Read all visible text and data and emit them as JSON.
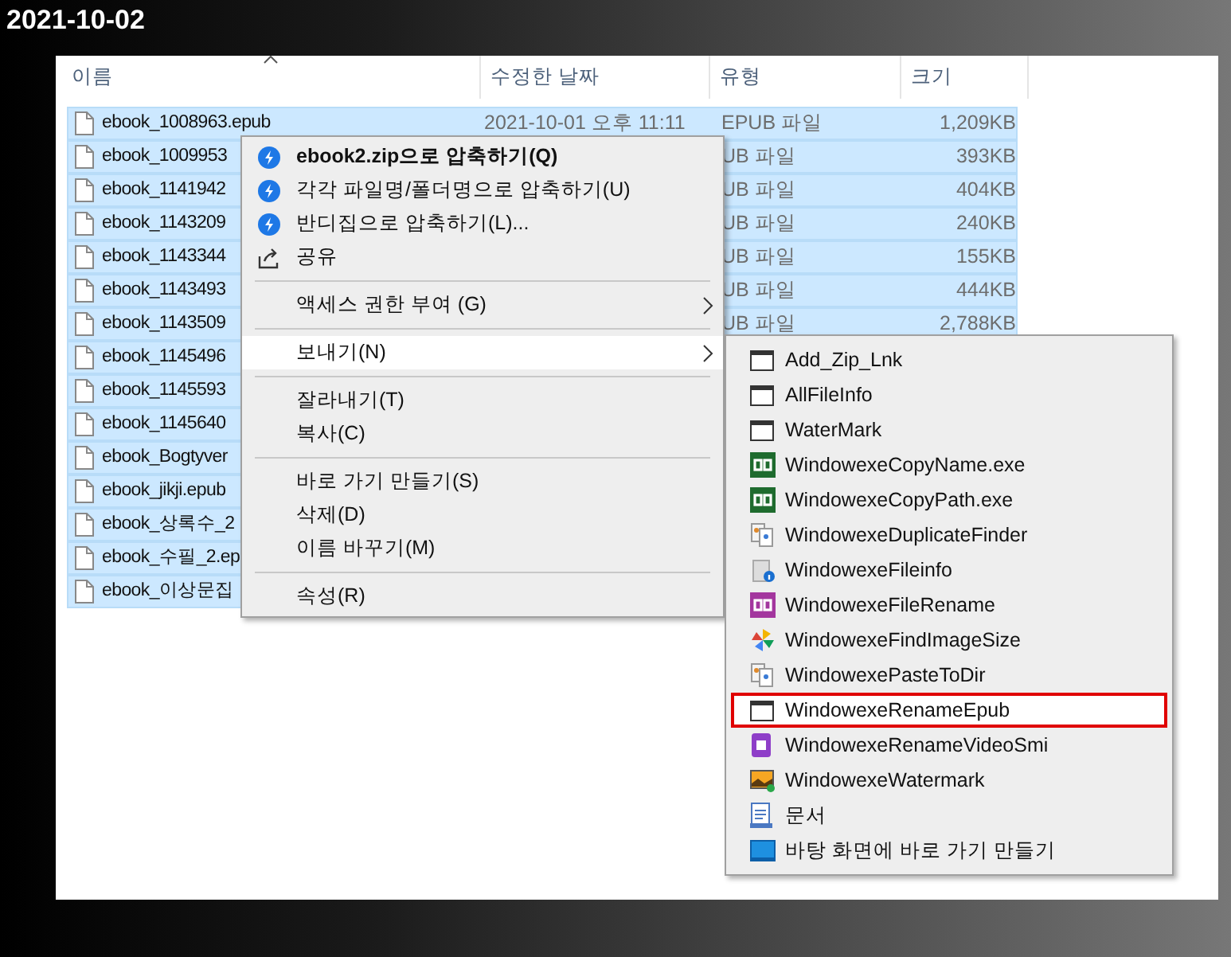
{
  "date_label": "2021-10-02",
  "columns": [
    {
      "label": "이름",
      "sorted": true
    },
    {
      "label": "수정한 날짜",
      "sorted": false
    },
    {
      "label": "유형",
      "sorted": false
    },
    {
      "label": "크기",
      "sorted": false
    }
  ],
  "files": [
    {
      "name": "ebook_1008963.epub",
      "date": "2021-10-01 오후 11:11",
      "type": "EPUB 파일",
      "size": "1,209KB",
      "selected": true
    },
    {
      "name": "ebook_1009953",
      "type": "UB 파일",
      "size": "393KB",
      "selected": true
    },
    {
      "name": "ebook_1141942",
      "type": "UB 파일",
      "size": "404KB",
      "selected": true
    },
    {
      "name": "ebook_1143209",
      "type": "UB 파일",
      "size": "240KB",
      "selected": true
    },
    {
      "name": "ebook_1143344",
      "type": "UB 파일",
      "size": "155KB",
      "selected": true
    },
    {
      "name": "ebook_1143493",
      "type": "UB 파일",
      "size": "444KB",
      "selected": true
    },
    {
      "name": "ebook_1143509",
      "type": "UB 파일",
      "size": "2,788KB",
      "selected": true
    },
    {
      "name": "ebook_1145496",
      "selected": true
    },
    {
      "name": "ebook_1145593",
      "selected": true
    },
    {
      "name": "ebook_1145640",
      "selected": true
    },
    {
      "name": "ebook_Bogtyver",
      "selected": true
    },
    {
      "name": "ebook_jikji.epub",
      "selected": true
    },
    {
      "name": "ebook_상록수_2",
      "selected": true
    },
    {
      "name": "ebook_수필_2.ep",
      "selected": true
    },
    {
      "name": "ebook_이상문집",
      "selected": true
    }
  ],
  "context_menu": [
    {
      "kind": "zip",
      "label": "ebook2.zip으로 압축하기(Q)",
      "bold": true,
      "arrow": false,
      "highlighted": false
    },
    {
      "kind": "zip",
      "label": "각각 파일명/폴더명으로 압축하기(U)",
      "bold": false,
      "arrow": false,
      "highlighted": false
    },
    {
      "kind": "zip",
      "label": "반디집으로 압축하기(L)...",
      "bold": false,
      "arrow": false,
      "highlighted": false
    },
    {
      "kind": "share",
      "label": "공유",
      "bold": false,
      "arrow": false,
      "highlighted": false
    },
    {
      "kind": "separator"
    },
    {
      "kind": "item",
      "label": "액세스 권한 부여 (G)",
      "bold": false,
      "arrow": true,
      "highlighted": false
    },
    {
      "kind": "separator"
    },
    {
      "kind": "item",
      "label": "보내기(N)",
      "bold": false,
      "arrow": true,
      "highlighted": true
    },
    {
      "kind": "separator"
    },
    {
      "kind": "item",
      "label": "잘라내기(T)",
      "bold": false,
      "arrow": false,
      "highlighted": false
    },
    {
      "kind": "item",
      "label": "복사(C)",
      "bold": false,
      "arrow": false,
      "highlighted": false
    },
    {
      "kind": "separator"
    },
    {
      "kind": "item",
      "label": "바로 가기 만들기(S)",
      "bold": false,
      "arrow": false,
      "highlighted": false
    },
    {
      "kind": "item",
      "label": "삭제(D)",
      "bold": false,
      "arrow": false,
      "highlighted": false
    },
    {
      "kind": "item",
      "label": "이름 바꾸기(M)",
      "bold": false,
      "arrow": false,
      "highlighted": false
    },
    {
      "kind": "separator"
    },
    {
      "kind": "item",
      "label": "속성(R)",
      "bold": false,
      "arrow": false,
      "highlighted": false
    }
  ],
  "send_to_menu": [
    {
      "label": "Add_Zip_Lnk",
      "outlined": false
    },
    {
      "label": "AllFileInfo",
      "outlined": false
    },
    {
      "label": "WaterMark",
      "outlined": false
    },
    {
      "label": "WindowexeCopyName.exe",
      "outlined": false
    },
    {
      "label": "WindowexeCopyPath.exe",
      "outlined": false
    },
    {
      "label": "WindowexeDuplicateFinder",
      "outlined": false
    },
    {
      "label": "WindowexeFileinfo",
      "outlined": false
    },
    {
      "label": "WindowexeFileRename",
      "outlined": false
    },
    {
      "label": "WindowexeFindImageSize",
      "outlined": false
    },
    {
      "label": "WindowexePasteToDir",
      "outlined": false
    },
    {
      "label": "WindowexeRenameEpub",
      "outlined": true
    },
    {
      "label": "WindowexeRenameVideoSmi",
      "outlined": false
    },
    {
      "label": "WindowexeWatermark",
      "outlined": false
    },
    {
      "label": "문서",
      "outlined": false
    },
    {
      "label": "바탕 화면에 바로 가기 만들기",
      "outlined": false
    }
  ]
}
